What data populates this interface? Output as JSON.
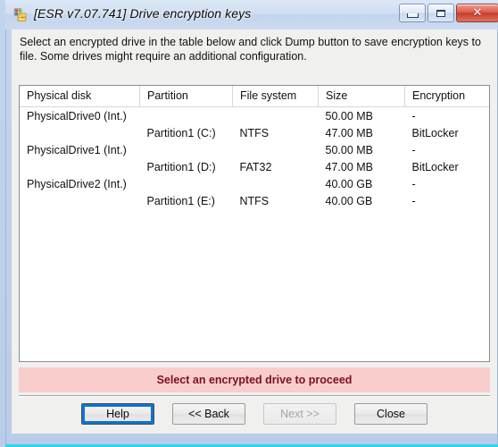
{
  "window": {
    "title": "[ESR v7.07.741]  Drive encryption keys",
    "icon": "app-drive-key-icon",
    "controls": {
      "minimize": "minimize-icon",
      "maximize": "maximize-icon",
      "close": "✕"
    }
  },
  "content": {
    "instructions": "Select an encrypted drive in the table below and click Dump button to save encryption keys to file. Some drives might require an additional configuration."
  },
  "table": {
    "columns": [
      "Physical disk",
      "Partition",
      "File system",
      "Size",
      "Encryption",
      ""
    ],
    "rows": [
      {
        "disk": "PhysicalDrive0 (Int.)",
        "partition": "",
        "filesystem": "",
        "size": "50.00 MB",
        "encryption": "-",
        "extra": ""
      },
      {
        "disk": "",
        "partition": "Partition1 (C:)",
        "filesystem": "NTFS",
        "size": "47.00 MB",
        "encryption": "BitLocker",
        "extra": ""
      },
      {
        "disk": "PhysicalDrive1 (Int.)",
        "partition": "",
        "filesystem": "",
        "size": "50.00 MB",
        "encryption": "-",
        "extra": ""
      },
      {
        "disk": "",
        "partition": "Partition1 (D:)",
        "filesystem": "FAT32",
        "size": "47.00 MB",
        "encryption": "BitLocker",
        "extra": ""
      },
      {
        "disk": "PhysicalDrive2 (Int.)",
        "partition": "",
        "filesystem": "",
        "size": "40.00 GB",
        "encryption": "-",
        "extra": ""
      },
      {
        "disk": "",
        "partition": "Partition1 (E:)",
        "filesystem": "NTFS",
        "size": "40.00 GB",
        "encryption": "-",
        "extra": ""
      }
    ]
  },
  "status": {
    "message": "Select an encrypted drive to proceed",
    "background_color": "#f9cdcb",
    "text_color": "#7a1020"
  },
  "buttons": {
    "help": "Help",
    "back": "<< Back",
    "next": "Next >>",
    "close": "Close"
  }
}
